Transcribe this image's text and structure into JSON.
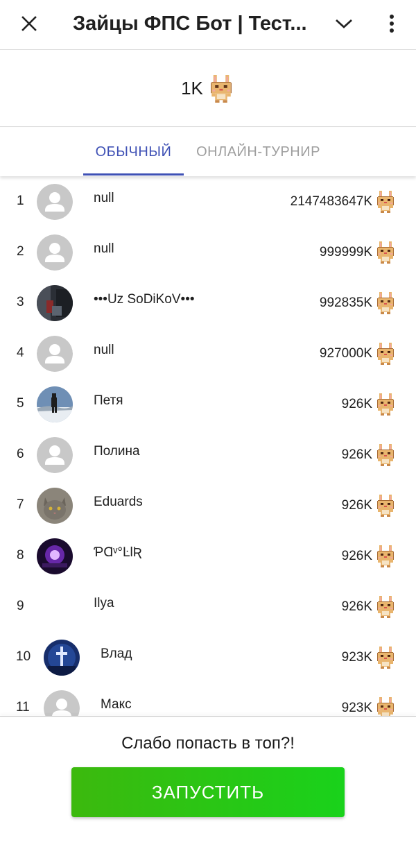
{
  "header": {
    "title": "Зайцы ФПС Бот | Тест...",
    "close_icon": "close-icon",
    "chevron_icon": "chevron-down-icon",
    "menu_icon": "more-vertical-icon"
  },
  "balance": {
    "value": "1K",
    "icon": "bunny-icon"
  },
  "tabs": [
    {
      "label": "ОБЫЧНЫЙ",
      "active": true
    },
    {
      "label": "ОНЛАЙН-ТУРНИР",
      "active": false
    }
  ],
  "leaderboard": [
    {
      "rank": "1",
      "name": "null",
      "score": "2147483647K",
      "avatar": "placeholder"
    },
    {
      "rank": "2",
      "name": "null",
      "score": "999999K",
      "avatar": "placeholder"
    },
    {
      "rank": "3",
      "name": "•••Uz SoDiKoV•••",
      "score": "992835K",
      "avatar": "photo-dark-room"
    },
    {
      "rank": "4",
      "name": "null",
      "score": "927000K",
      "avatar": "placeholder"
    },
    {
      "rank": "5",
      "name": "Петя",
      "score": "926K",
      "avatar": "photo-person-snow"
    },
    {
      "rank": "6",
      "name": "Полина",
      "score": "926K",
      "avatar": "placeholder"
    },
    {
      "rank": "7",
      "name": "Eduards",
      "score": "926K",
      "avatar": "photo-cat"
    },
    {
      "rank": "8",
      "name": "ƤⱭᵛ°ĿƖƦ",
      "score": "926K",
      "avatar": "photo-purple-glow"
    },
    {
      "rank": "9",
      "name": "Ilya",
      "score": "926K",
      "avatar": "none"
    },
    {
      "rank": "10",
      "name": "Влад",
      "score": "923K",
      "avatar": "photo-blue-cross"
    },
    {
      "rank": "11",
      "name": "Макс",
      "score": "923K",
      "avatar": "placeholder"
    }
  ],
  "footer": {
    "prompt": "Слабо попасть в топ?!",
    "launch_label": "ЗАПУСТИТЬ"
  },
  "colors": {
    "accent": "#3f51b5",
    "inactive_tab": "#9e9e9e",
    "launch_start": "#3cb90e",
    "launch_end": "#19d21b",
    "placeholder_avatar": "#c8c8c8"
  }
}
